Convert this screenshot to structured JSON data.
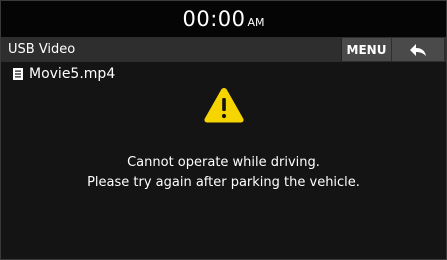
{
  "status_bar": {
    "time": "00:00",
    "ampm": "AM"
  },
  "header": {
    "title": "USB Video",
    "menu_label": "MENU"
  },
  "file": {
    "name": "Movie5.mp4"
  },
  "message": {
    "line1": "Cannot operate while driving.",
    "line2": "Please try again after parking the vehicle."
  },
  "icons": {
    "back": "back-arrow-icon",
    "file": "video-file-icon",
    "warning": "warning-icon"
  },
  "colors": {
    "warning_yellow": "#f5d400",
    "header_bg": "#2e2e2e",
    "button_bg": "#4a4a4a",
    "screen_bg": "#141414"
  }
}
